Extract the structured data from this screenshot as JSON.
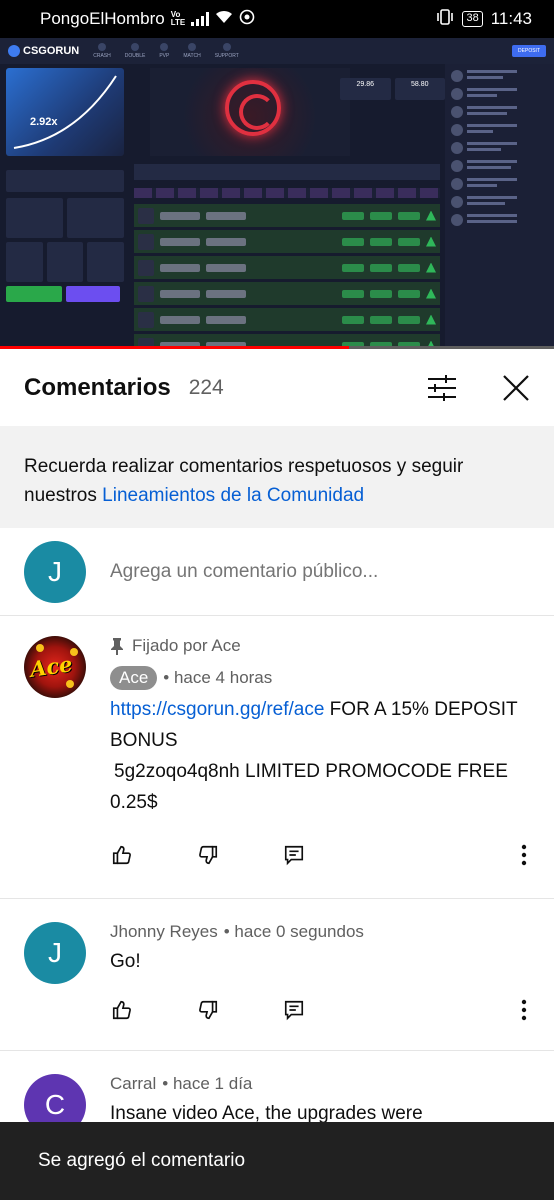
{
  "status_bar": {
    "carrier": "PongoElHombro",
    "volte_top": "Vo",
    "volte_bottom": "LTE",
    "battery": "38",
    "time": "11:43"
  },
  "video": {
    "site_logo": "CSGORUN",
    "nav": [
      "CRASH",
      "DOUBLE",
      "PVP",
      "MATCH",
      "SUPPORT"
    ],
    "deposit_label": "DEPOSIT",
    "multiplier": "2.92x",
    "bet_left": "29.86",
    "bet_right": "58.80",
    "progress_percent": 63
  },
  "comments_header": {
    "title": "Comentarios",
    "count": "224"
  },
  "notice": {
    "text": "Recuerda realizar comentarios respetuosos y seguir nuestros ",
    "link": "Lineamientos de la Comunidad"
  },
  "add_comment": {
    "avatar_letter": "J",
    "placeholder": "Agrega un comentario público..."
  },
  "comments": [
    {
      "pinned_label": "Fijado por Ace",
      "author": "Ace",
      "time": "• hace 4 horas",
      "link": "https://csgorun.gg/ref/ace",
      "text_after_link": " FOR A 15% DEPOSIT BONUS",
      "line2": "5g2zoqo4q8nh  LIMITED PROMOCODE FREE 0.25$"
    },
    {
      "avatar_letter": "J",
      "author": "Jhonny Reyes",
      "time": "• hace 0 segundos",
      "text": "Go!"
    },
    {
      "avatar_letter": "C",
      "author": "Carral",
      "time": "• hace 1 día",
      "text": "Insane video Ace, the upgrades were"
    }
  ],
  "toast": "Se agregó el comentario",
  "icons": [
    "sort-filter-icon",
    "close-icon",
    "pin-icon",
    "like-icon",
    "dislike-icon",
    "reply-icon",
    "more-vert-icon"
  ],
  "colors": {
    "link": "#065fd4",
    "progress": "#ff0000",
    "avatar_j": "#1a8ba3",
    "avatar_c": "#5e35b1",
    "toast_bg": "#212121"
  }
}
